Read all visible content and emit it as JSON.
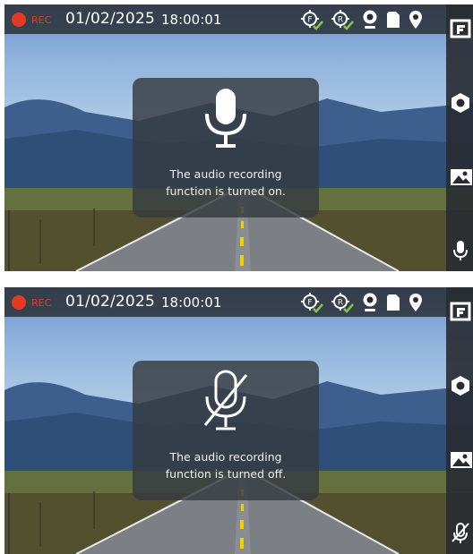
{
  "colors": {
    "rec_red": "#e53a22",
    "bar_bg": "#282b32",
    "toast_bg": "#363a40",
    "text_white": "#ffffff",
    "badge_green": "#8bc34a"
  },
  "status_bar": {
    "rec_label": "REC",
    "date": "01/02/2025",
    "time": "18:00:01",
    "icons": [
      "front-camera-icon",
      "rear-camera-icon",
      "webcam-icon",
      "sd-card-icon",
      "gps-location-icon"
    ]
  },
  "side_rail": {
    "icons": [
      "front-camera-toggle-icon",
      "settings-gear-icon",
      "gallery-icon",
      "microphone-icon"
    ]
  },
  "badges": {
    "front": "F",
    "rear": "R"
  },
  "panels": [
    {
      "mic_state": "on",
      "message_line1": "The audio recording",
      "message_line2": "function is turned on."
    },
    {
      "mic_state": "off",
      "message_line1": "The audio recording",
      "message_line2": "function is turned off."
    }
  ]
}
